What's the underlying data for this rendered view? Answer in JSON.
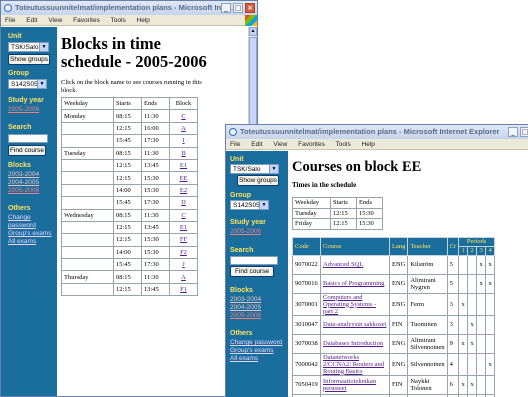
{
  "window1": {
    "title": "Toteutussuunnitelmat/implementation plans - Microsoft Inte...",
    "menu": [
      "File",
      "Edit",
      "View",
      "Favorites",
      "Tools",
      "Help"
    ],
    "sidebar": {
      "unit_label": "Unit",
      "unit_value": "TSK/Salo",
      "show_groups": "Show groups",
      "group_label": "Group",
      "group_value": "S142S05",
      "study_year_label": "Study year",
      "study_year_value": "2005-2006",
      "search_label": "Search",
      "find_course": "Find course",
      "blocks_label": "Blocks",
      "blocks": [
        "2003-2004",
        "2004-2005",
        "2005-2006"
      ],
      "others_label": "Others",
      "others": [
        "Change password",
        "Group's exams",
        "All exams"
      ]
    },
    "heading": "Blocks in time schedule - 2005-2006",
    "description": "Click on the block name to see courses running in this block.",
    "table": {
      "headers": [
        "Weekday",
        "Starts",
        "Ends",
        "Block"
      ],
      "rows": [
        [
          "Monday",
          "08:15",
          "11:30",
          "C"
        ],
        [
          "",
          "12:15",
          "16:00",
          "A"
        ],
        [
          "",
          "15:45",
          "17:30",
          "I"
        ],
        [
          "Tuesday",
          "08:15",
          "11:30",
          "B"
        ],
        [
          "",
          "12:15",
          "13:45",
          "E1"
        ],
        [
          "",
          "12:15",
          "15:30",
          "EE"
        ],
        [
          "",
          "14:00",
          "15:30",
          "E2"
        ],
        [
          "",
          "15:45",
          "17:30",
          "D"
        ],
        [
          "Wednesday",
          "08:15",
          "11:30",
          "C"
        ],
        [
          "",
          "12:15",
          "13:45",
          "E1"
        ],
        [
          "",
          "12:15",
          "15:30",
          "FF"
        ],
        [
          "",
          "14:00",
          "15:30",
          "F2"
        ],
        [
          "",
          "15:45",
          "17:30",
          "J"
        ],
        [
          "Thursday",
          "08:15",
          "11:30",
          "A"
        ],
        [
          "",
          "12:15",
          "13:45",
          "F1"
        ]
      ]
    }
  },
  "window2": {
    "title": "Toteutussuunnitelmat/implementation plans - Microsoft Internet Explorer",
    "menu": [
      "File",
      "Edit",
      "View",
      "Favorites",
      "Tools",
      "Help"
    ],
    "sidebar": {
      "unit_label": "Unit",
      "unit_value": "TSK/Salo",
      "show_groups": "Show groups",
      "group_label": "Group",
      "group_value": "S142S05",
      "study_year_label": "Study year",
      "study_year_value": "2005-2006",
      "search_label": "Search",
      "find_course": "Find course",
      "blocks_label": "Blocks",
      "blocks": [
        "2003-2004",
        "2004-2005",
        "2005-2006"
      ],
      "others_label": "Others",
      "others": [
        "Change password",
        "Group's exams",
        "All exams"
      ]
    },
    "heading": "Courses on block EE",
    "subheading": "Times in the schedule",
    "times": {
      "headers": [
        "Weekday",
        "Starts",
        "Ends"
      ],
      "rows": [
        [
          "Tuesday",
          "12:15",
          "15:30"
        ],
        [
          "Friday",
          "12:15",
          "15:30"
        ]
      ]
    },
    "courses": {
      "headers": [
        "Code",
        "Course",
        "Lang",
        "Teacher",
        "Cr",
        "Periods"
      ],
      "period_headers": [
        "1",
        "2",
        "3",
        "4"
      ],
      "rows": [
        {
          "code": "9070022",
          "course": "Advanced SQL",
          "lang": "ENG",
          "teacher": "Kilström",
          "cr": "5",
          "p": [
            "",
            "",
            "x",
            "x"
          ]
        },
        {
          "code": "9070016",
          "course": "Basics of Programming",
          "lang": "ENG",
          "teacher": "Alimirani Nygren",
          "cr": "5",
          "p": [
            "",
            "",
            "x",
            "x"
          ]
        },
        {
          "code": "3070001",
          "course": "Computers and Operating Systems - part 2",
          "lang": "ENG",
          "teacher": "Ferm",
          "cr": "3",
          "p": [
            "x",
            "",
            "",
            ""
          ]
        },
        {
          "code": "3010047",
          "course": "Data-analyysin sakkoset",
          "lang": "FIN",
          "teacher": "Tuominen",
          "cr": "3",
          "p": [
            "",
            "x",
            "",
            ""
          ]
        },
        {
          "code": "3070038",
          "course": "Databases Introduction",
          "lang": "ENG",
          "teacher": "Alimirani Silvennoinen",
          "cr": "9",
          "p": [
            "x",
            "x",
            "",
            ""
          ]
        },
        {
          "code": "7000042",
          "course": "Datanetworks 2/CCNA2: Routers and Routing Basics",
          "lang": "ENG",
          "teacher": "Silvennoinen",
          "cr": "4",
          "p": [
            "",
            "",
            "",
            "x"
          ]
        },
        {
          "code": "7050419",
          "course": "Informaatioteknikan perusteet",
          "lang": "FIN",
          "teacher": "Naykki Tolonen",
          "cr": "6",
          "p": [
            "x",
            "x",
            "",
            ""
          ]
        },
        {
          "code": "3000190",
          "course": "Tietoeknaiikka",
          "lang": "FIN",
          "teacher": "Silvennoinen",
          "cr": "6",
          "p": [
            "x",
            "x",
            "",
            ""
          ]
        }
      ]
    }
  }
}
